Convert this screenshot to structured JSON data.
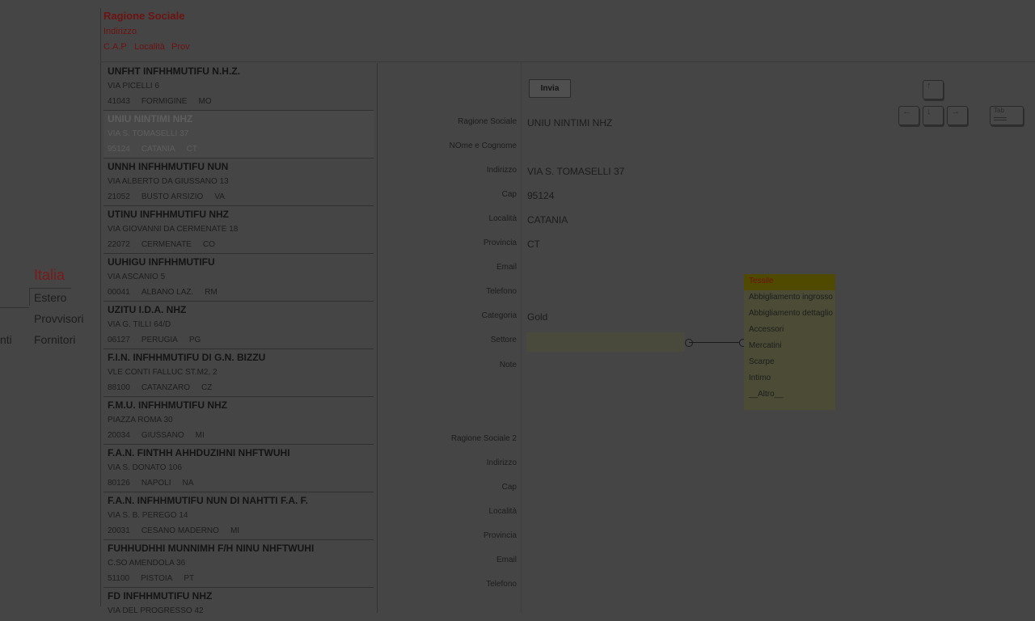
{
  "nav": {
    "items": [
      {
        "label": "Italia"
      },
      {
        "label": "Estero"
      },
      {
        "label": "Provvisori"
      },
      {
        "label": "Fornitori"
      },
      {
        "label": "nti"
      }
    ]
  },
  "header": {
    "title": "Ragione Sociale",
    "address": "Indirizzo",
    "cap": "C.A.P",
    "locality": "Località",
    "prov": "Prov"
  },
  "records": [
    {
      "name": "UNFHT INFHHMUTIFU N.H.Z.",
      "address": "VIA PICELLI 6",
      "cap": "41043",
      "city": "FORMIGINE",
      "prov": "MO"
    },
    {
      "name": "UNIU NINTIMI NHZ",
      "address": "VIA S. TOMASELLI 37",
      "cap": "95124",
      "city": "CATANIA",
      "prov": "CT"
    },
    {
      "name": "UNNH INFHHMUTIFU NUN",
      "address": "VIA ALBERTO DA GIUSSANO 13",
      "cap": "21052",
      "city": "BUSTO ARSIZIO",
      "prov": "VA"
    },
    {
      "name": "UTINU INFHHMUTIFU NHZ",
      "address": "VIA GIOVANNI DA CERMENATE 18",
      "cap": "22072",
      "city": "CERMENATE",
      "prov": "CO"
    },
    {
      "name": "UUHIGU INFHHMUTIFU",
      "address": "VIA ASCANIO 5",
      "cap": "00041",
      "city": "ALBANO LAZ.",
      "prov": "RM"
    },
    {
      "name": "UZITU I.D.A. NHZ",
      "address": "VIA G. TILLI 64/D",
      "cap": "06127",
      "city": "PERUGIA",
      "prov": "PG"
    },
    {
      "name": "F.I.N. INFHHMUTIFU DI G.N. BIZZU",
      "address": "VLE CONTI FALLUC ST.M2, 2",
      "cap": "88100",
      "city": "CATANZARO",
      "prov": "CZ"
    },
    {
      "name": "F.M.U. INFHHMUTIFU NHZ",
      "address": "PIAZZA ROMA 30",
      "cap": "20034",
      "city": "GIUSSANO",
      "prov": "MI"
    },
    {
      "name": "F.A.N. FINTHH AHHDUZIHNI NHFTWUHI",
      "address": "VIA S. DONATO 106",
      "cap": "80126",
      "city": "NAPOLI",
      "prov": "NA"
    },
    {
      "name": "F.A.N. INFHHMUTIFU NUN DI NAHTTI F.A. F.",
      "address": "VIA S. B. PEREGO 14",
      "cap": "20031",
      "city": "CESANO MADERNO",
      "prov": "MI"
    },
    {
      "name": "FUHHUDHHI MUNNIMH F/H NINU NHFTWUHI",
      "address": "C.SO AMENDOLA 36",
      "cap": "51100",
      "city": "PISTOIA",
      "prov": "PT"
    },
    {
      "name": "FD INFHHMUTIFU NHZ",
      "address": "VIA DEL PROGRESSO 42",
      "cap": "",
      "city": "",
      "prov": ""
    }
  ],
  "form": {
    "send_label": "Invia",
    "labels": {
      "ragione": "Ragione Sociale",
      "nome": "NOme e Cognome",
      "indirizzo": "Indirizzo",
      "cap": "Cap",
      "localita": "Località",
      "provincia": "Provincia",
      "email": "Email",
      "telefono": "Telefono",
      "categoria": "Categoria",
      "settore": "Settore",
      "note": "Note",
      "ragione2": "Ragione Sociale 2",
      "indirizzo2": "Indirizzo",
      "cap2": "Cap",
      "localita2": "Località",
      "provincia2": "Provincia",
      "email2": "Email",
      "telefono2": "Telefono"
    },
    "values": {
      "ragione": "UNIU NINTIMI NHZ",
      "indirizzo": "VIA S. TOMASELLI 37",
      "cap": "95124",
      "localita": "CATANIA",
      "provincia": "CT",
      "categoria": "Gold"
    }
  },
  "sectors": [
    "Tessile",
    "Abbigliamento ingrosso",
    "Abbigliamento dettaglio",
    "Accessori",
    "Mercatini",
    "Scarpe",
    "Intimo",
    "__Altro__"
  ],
  "keys": {
    "up": "↑",
    "left": "←",
    "down": "↓",
    "right": "→",
    "tab": "Tab"
  },
  "colors": {
    "accent": "#7a1a1a",
    "header_text": "#6e1212",
    "sector_highlight": "#4f4a00"
  }
}
